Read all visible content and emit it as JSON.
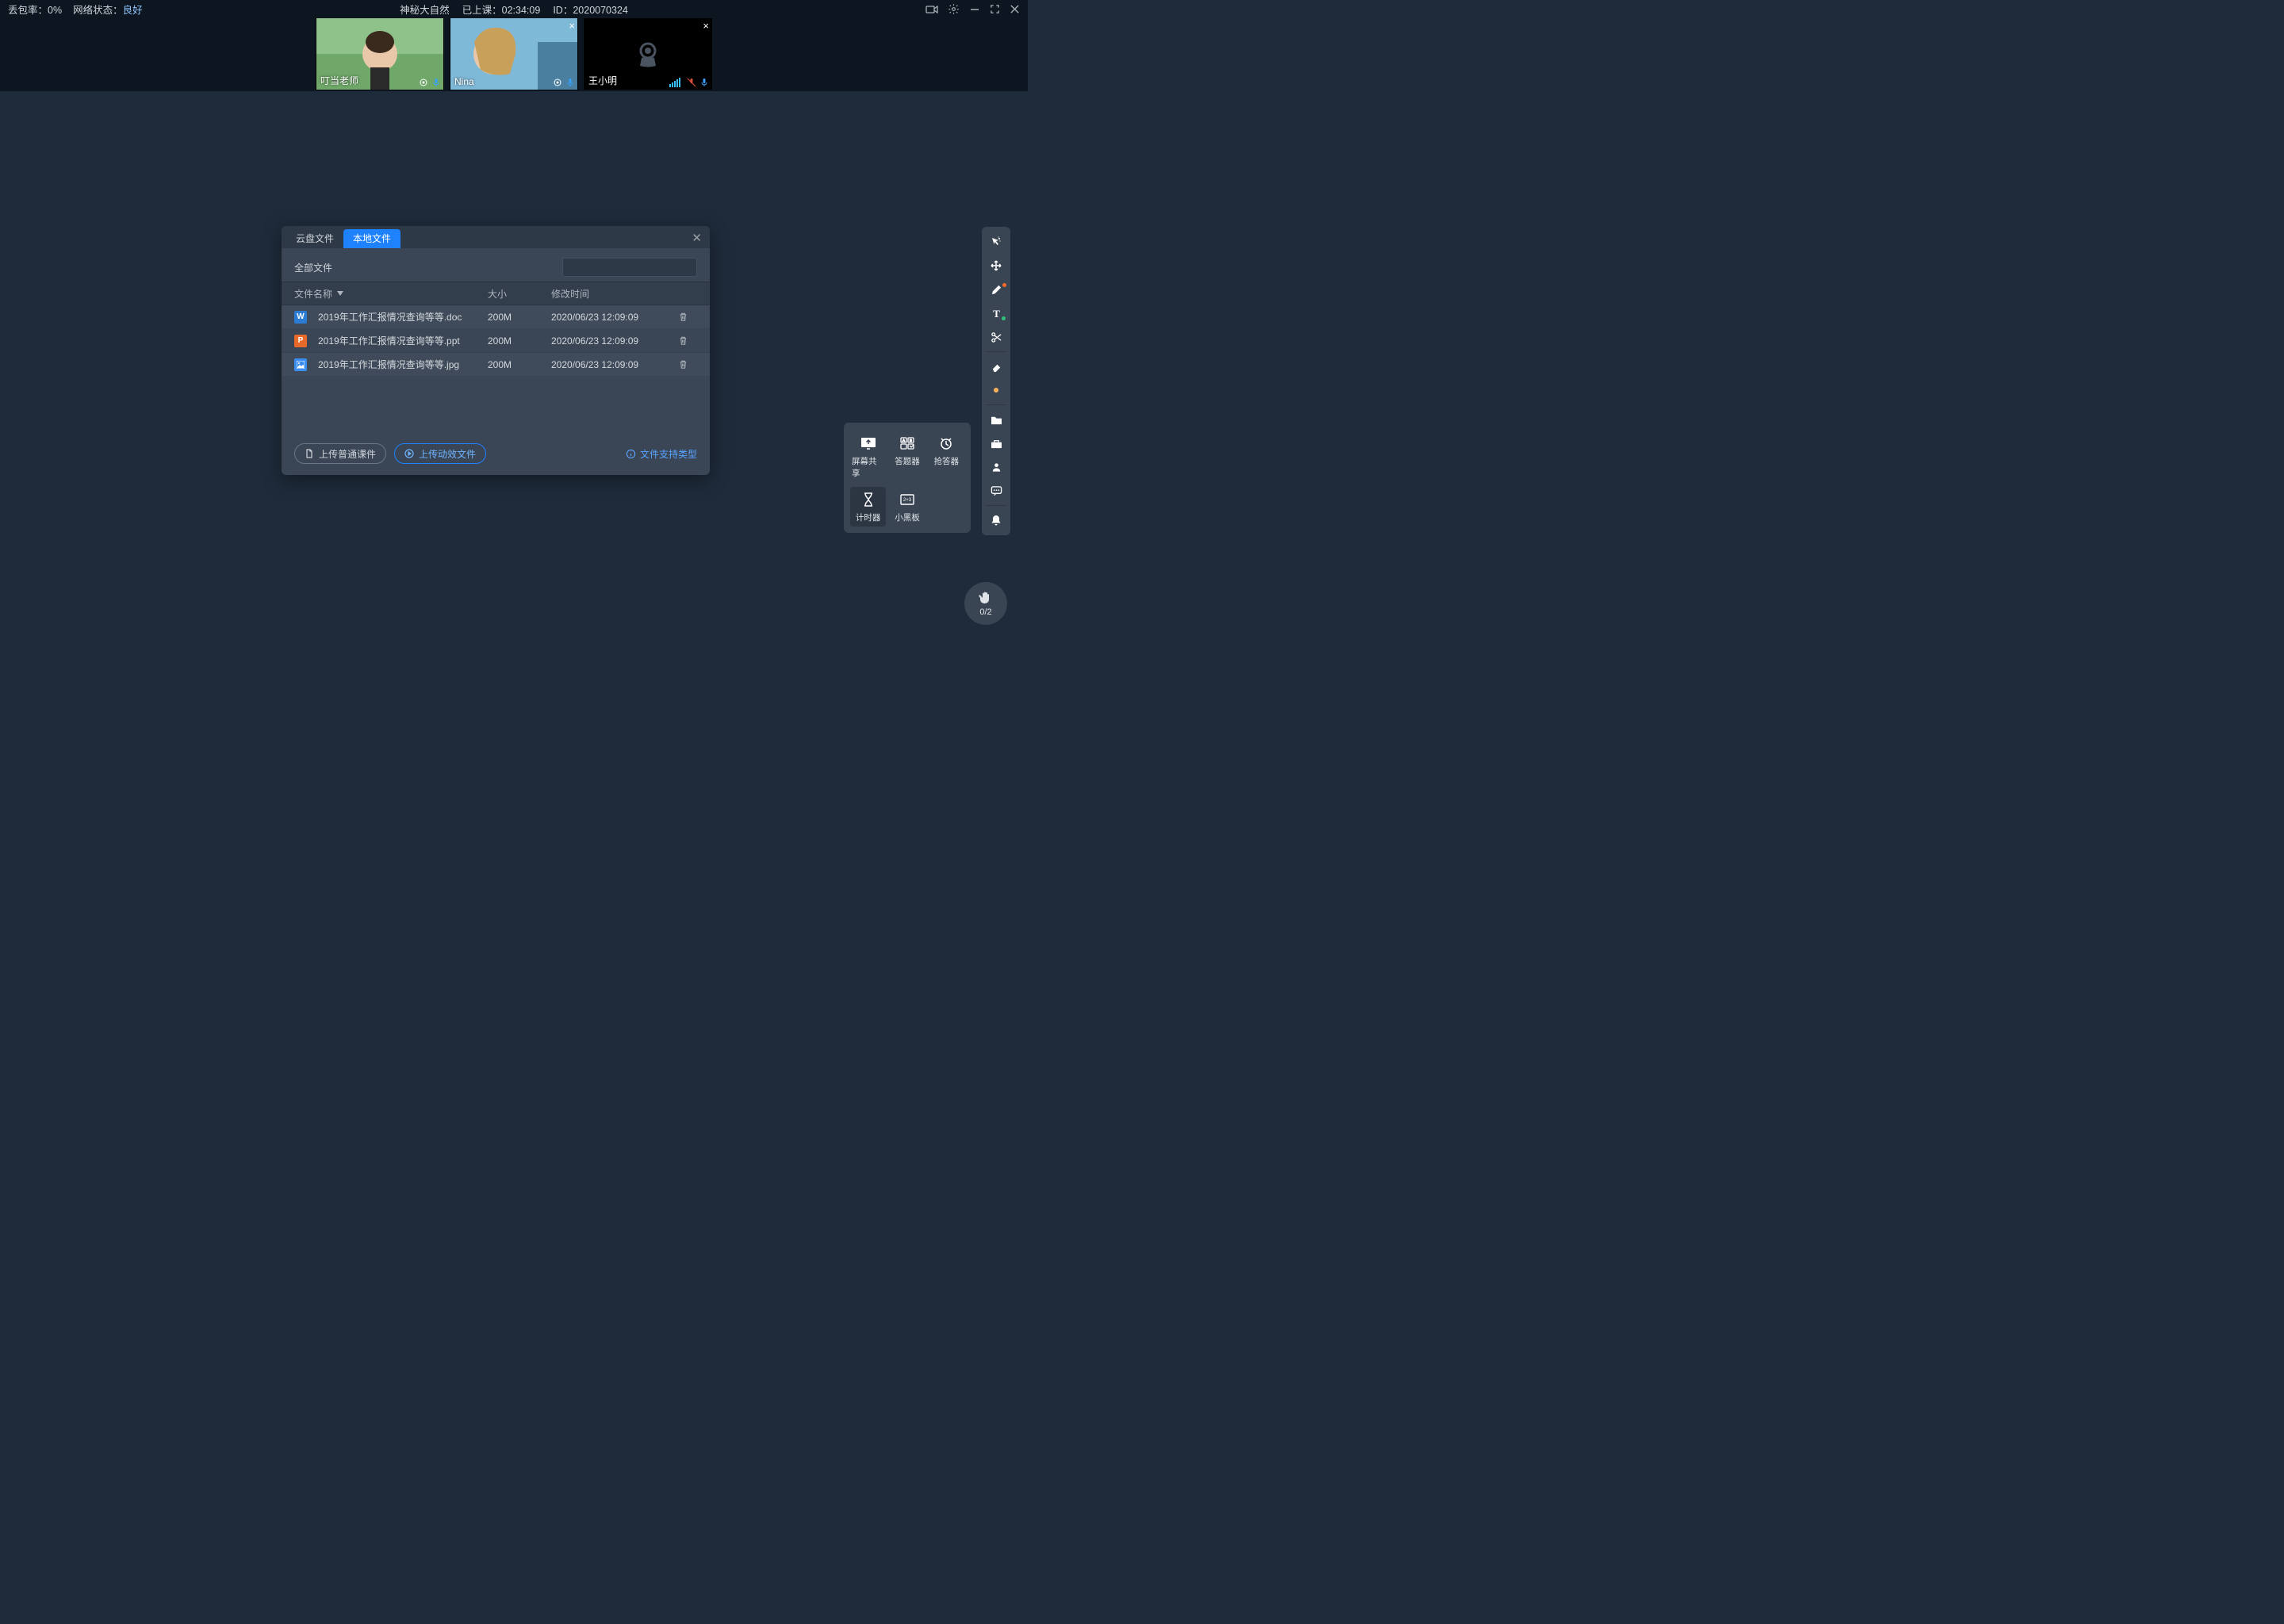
{
  "top": {
    "packet_loss_label": "丢包率：",
    "packet_loss_value": "0%",
    "net_label": "网络状态：",
    "net_value": "良好",
    "title": "神秘大自然",
    "elapsed_label": "已上课：",
    "elapsed_value": "02:34:09",
    "id_label": "ID：",
    "id_value": "2020070324"
  },
  "participants": [
    {
      "name": "叮当老师",
      "camera_off": false,
      "muted": false
    },
    {
      "name": "Nina",
      "camera_off": false,
      "muted": false
    },
    {
      "name": "王小明",
      "camera_off": true,
      "muted": true
    }
  ],
  "dialog": {
    "tabs": {
      "cloud": "云盘文件",
      "local": "本地文件"
    },
    "active_tab": "local",
    "breadcrumb": "全部文件",
    "columns": {
      "name": "文件名称",
      "size": "大小",
      "time": "修改时间"
    },
    "rows": [
      {
        "icon": "W",
        "icon_cls": "fi-w",
        "name": "2019年工作汇报情况查询等等.doc",
        "size": "200M",
        "time": "2020/06/23 12:09:09"
      },
      {
        "icon": "P",
        "icon_cls": "fi-p",
        "name": "2019年工作汇报情况查询等等.ppt",
        "size": "200M",
        "time": "2020/06/23 12:09:09"
      },
      {
        "icon": "",
        "icon_cls": "fi-i",
        "name": "2019年工作汇报情况查询等等.jpg",
        "size": "200M",
        "time": "2020/06/23 12:09:09"
      }
    ],
    "upload_normal": "上传普通课件",
    "upload_animated": "上传动效文件",
    "support_link": "文件支持类型"
  },
  "tools": {
    "screen_share": "屏幕共享",
    "answer_tool": "答题器",
    "buzzer": "抢答器",
    "timer": "计时器",
    "mini_board": "小黑板"
  },
  "hand": {
    "count": "0/2"
  }
}
